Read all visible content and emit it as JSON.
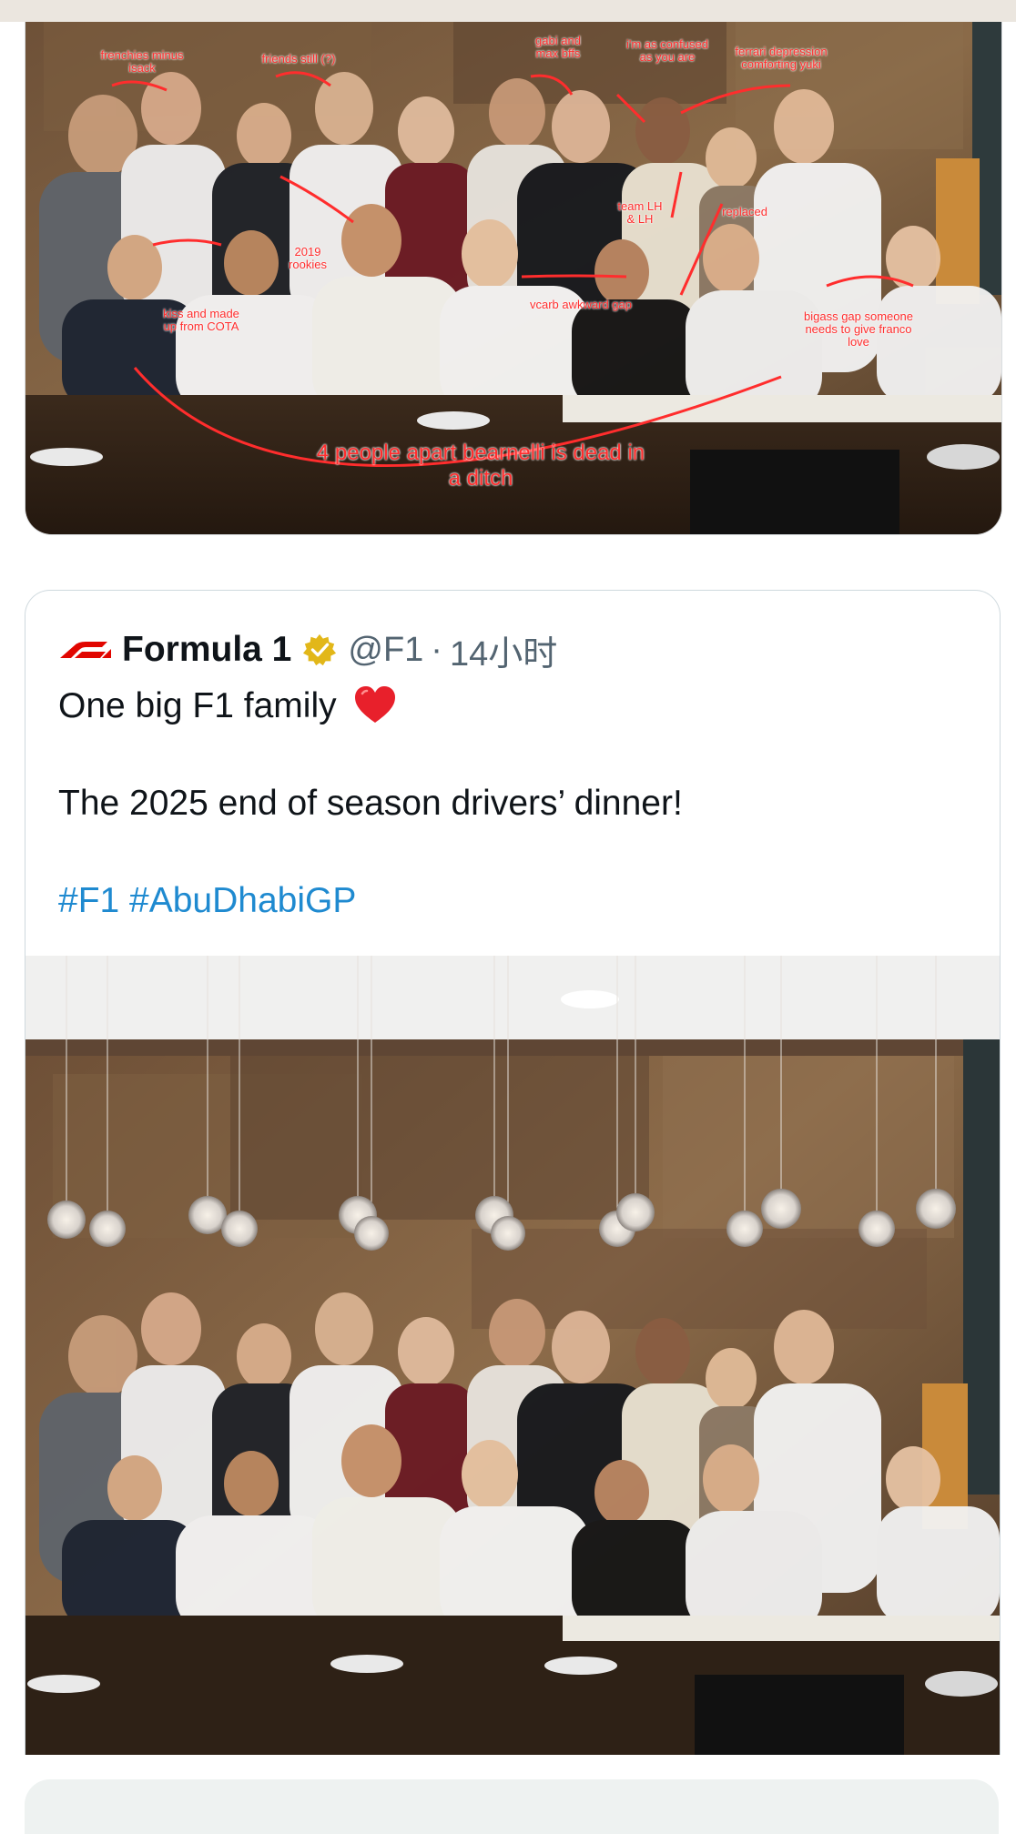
{
  "top_photo": {
    "annotations": [
      "frenchies minus\nisack",
      "friends still (?)",
      "gabi and\nmax bffs",
      "i'm as confused\nas you are",
      "ferrari depression\ncomforting yuki",
      "team LH\n& LH",
      "replaced",
      "2019\nrookies",
      "kiss and made\nup from COTA",
      "vcarb awkward gap",
      "bigass gap someone\nneeds to give franco\nlove",
      "4 people apart bearnelli is dead in\na ditch"
    ]
  },
  "quote_tweet": {
    "author_name": "Formula 1",
    "handle": "@F1",
    "separator": "·",
    "time": "14小时",
    "text_line_1": "One big F1 family",
    "text_line_2": "The 2025 end of season drivers’ dinner!",
    "hashtags": "#F1 #AbuDhabiGP"
  },
  "colors": {
    "hashtag": "#1f8ad0",
    "verified_badge": "#e2b719",
    "annotation_red": "#ff2d2d",
    "f1_red": "#e10600"
  }
}
